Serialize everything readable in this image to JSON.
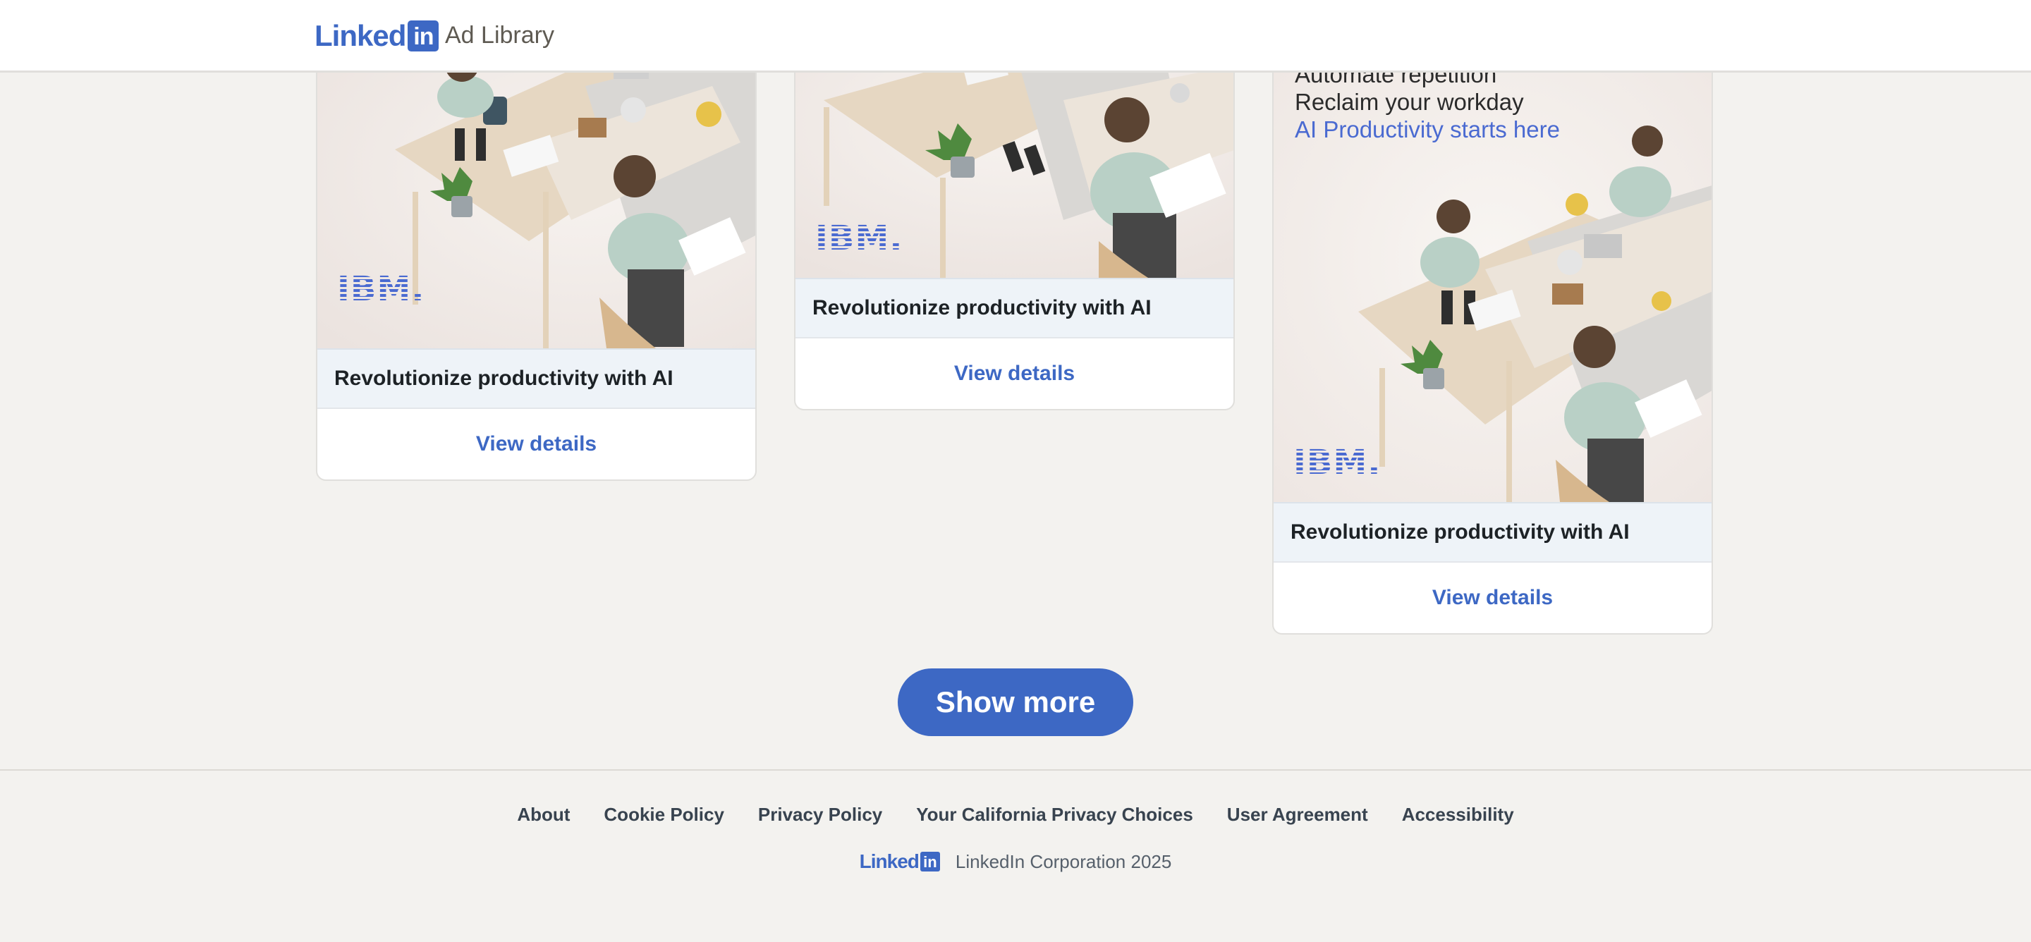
{
  "header": {
    "logo_word": "Linked",
    "logo_box": "in",
    "title": "Ad Library"
  },
  "cards": [
    {
      "title": "Revolutionize productivity with AI",
      "link": "View details",
      "logo_text": "IBM."
    },
    {
      "title": "Revolutionize productivity with AI",
      "link": "View details",
      "logo_text": "IBM."
    },
    {
      "title": "Revolutionize productivity with AI",
      "link": "View details",
      "logo_text": "IBM.",
      "overlay": [
        "Automate repetition",
        "Reclaim your workday",
        "AI Productivity starts here"
      ]
    }
  ],
  "show_more": "Show more",
  "footer": {
    "links": [
      "About",
      "Cookie Policy",
      "Privacy Policy",
      "Your California Privacy Choices",
      "User Agreement",
      "Accessibility"
    ],
    "logo_word": "Linked",
    "logo_box": "in",
    "copyright": "LinkedIn Corporation 2025"
  },
  "colors": {
    "brand": "#3d68c4",
    "background": "#f3f2ef"
  }
}
